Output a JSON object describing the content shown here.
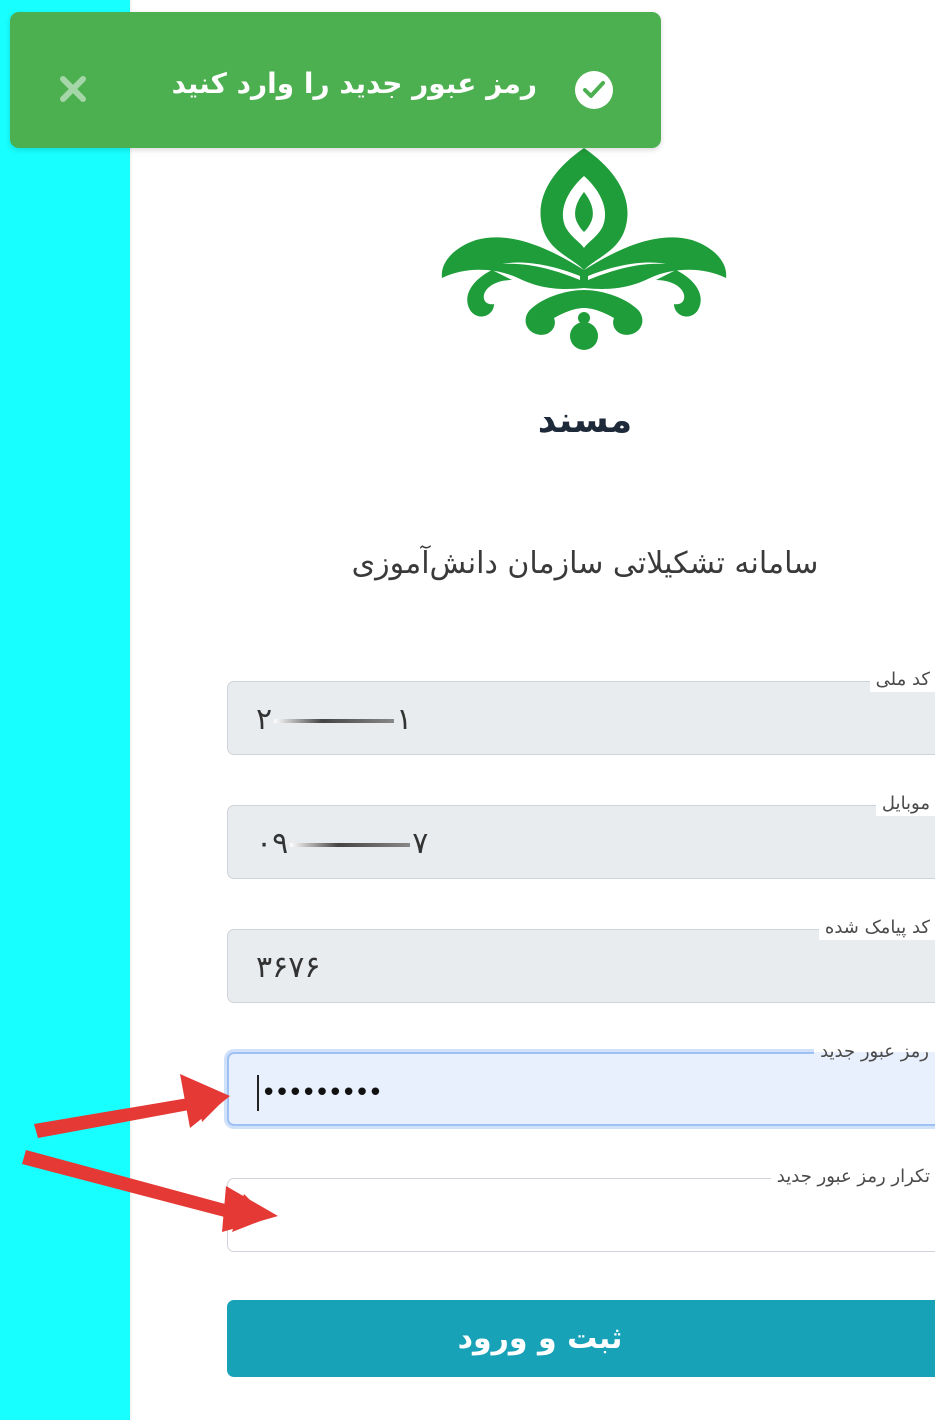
{
  "colors": {
    "side_strip": "#17ffff",
    "toast_background": "#4caf50",
    "logo_green": "#1f9d3a",
    "button_background": "#17a2b8",
    "annotation_arrow": "#e53935"
  },
  "toast": {
    "icon": "check-circle-icon",
    "message": "رمز عبور جدید را وارد کنید",
    "close_icon": "close-icon"
  },
  "brand": {
    "logo": "green-ornament-logo",
    "name": "مسند",
    "subtitle": "سامانه تشکیلاتی سازمان دانش‌آموزی"
  },
  "form": {
    "national_code": {
      "label": "کد ملی",
      "value_start": "۲",
      "value_end": "۱"
    },
    "mobile": {
      "label": "موبایل",
      "value_start": "۰۹",
      "value_end": "۷"
    },
    "sms_code": {
      "label": "کد پیامک شده",
      "value": "۳۶۷۶"
    },
    "new_password": {
      "label": "رمز عبور جدید",
      "value": "•••••••••"
    },
    "confirm_password": {
      "label": "تکرار رمز عبور جدید",
      "value": ""
    },
    "submit_label": "ثبت و ورود"
  }
}
